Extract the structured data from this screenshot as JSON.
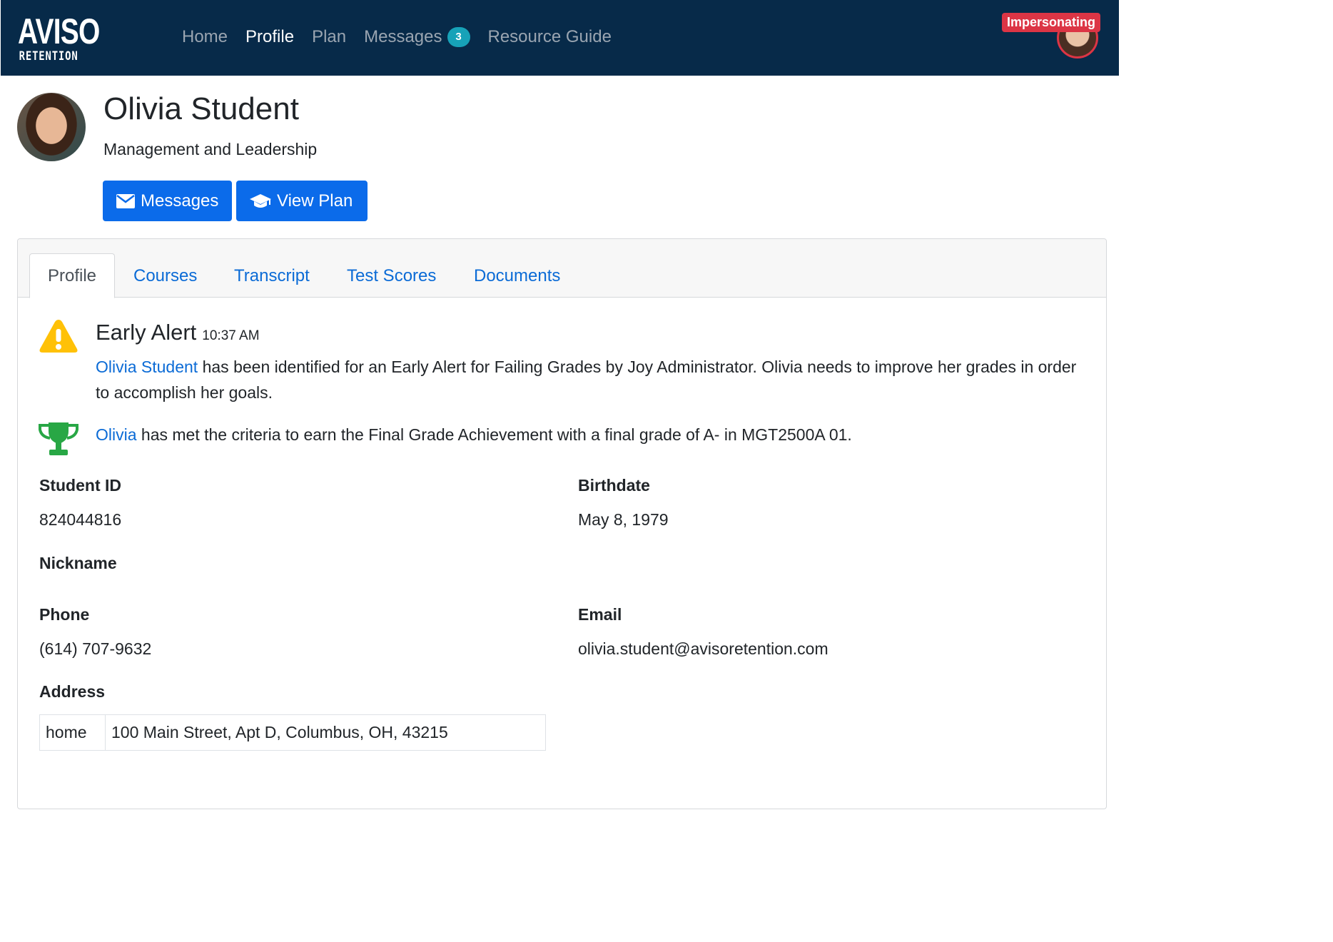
{
  "brand": {
    "logo_top": "AVISO",
    "logo_bottom": "RETENTION"
  },
  "nav": {
    "items": [
      {
        "label": "Home",
        "active": false
      },
      {
        "label": "Profile",
        "active": true
      },
      {
        "label": "Plan",
        "active": false
      },
      {
        "label": "Messages",
        "active": false,
        "badge": "3"
      },
      {
        "label": "Resource Guide",
        "active": false
      }
    ],
    "impersonating_label": "Impersonating"
  },
  "profile": {
    "name": "Olivia Student",
    "program": "Management and Leadership",
    "buttons": {
      "messages": "Messages",
      "view_plan": "View Plan"
    }
  },
  "tabs": [
    {
      "label": "Profile",
      "active": true
    },
    {
      "label": "Courses",
      "active": false
    },
    {
      "label": "Transcript",
      "active": false
    },
    {
      "label": "Test Scores",
      "active": false
    },
    {
      "label": "Documents",
      "active": false
    }
  ],
  "early_alert": {
    "title": "Early Alert",
    "time": "10:37 AM",
    "student_link": "Olivia Student",
    "text": " has been identified for an Early Alert for Failing Grades by Joy Administrator. Olivia needs to improve her grades in order to accomplish her goals."
  },
  "achievement": {
    "student_link": "Olivia",
    "text": " has met the criteria to earn the Final Grade Achievement with a final grade of A- in MGT2500A 01."
  },
  "fields": {
    "student_id": {
      "label": "Student ID",
      "value": "824044816"
    },
    "birthdate": {
      "label": "Birthdate",
      "value": "May 8, 1979"
    },
    "nickname": {
      "label": "Nickname",
      "value": ""
    },
    "phone": {
      "label": "Phone",
      "value": "(614) 707-9632"
    },
    "email": {
      "label": "Email",
      "value": "olivia.student@avisoretention.com"
    },
    "address": {
      "label": "Address",
      "rows": [
        {
          "type": "home",
          "line": "100 Main Street, Apt D, Columbus, OH, 43215"
        }
      ]
    }
  },
  "colors": {
    "navbar": "#072a49",
    "primary_button": "#0b6bea",
    "link": "#0b6bd6",
    "badge": "#17a2b8",
    "impersonating": "#dc3545",
    "warning_icon": "#ffc107",
    "trophy_icon": "#28a745"
  },
  "icons": {
    "messages_button": "envelope-icon",
    "view_plan_button": "graduation-cap-icon",
    "early_alert": "warning-icon",
    "achievement": "trophy-icon"
  }
}
